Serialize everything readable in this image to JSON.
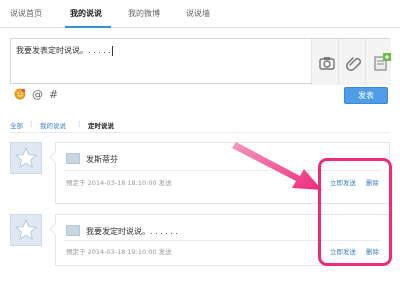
{
  "tabs": [
    {
      "label": "说说首页"
    },
    {
      "label": "我的说说"
    },
    {
      "label": "我的微博"
    },
    {
      "label": "说说墙"
    }
  ],
  "composer": {
    "text": "我要发表定时说说。. . . . ."
  },
  "tools": [
    "camera-icon",
    "link-icon",
    "schedule-icon"
  ],
  "toolbar_icons": [
    "emoji-icon",
    "mention-icon",
    "hashtag-icon"
  ],
  "send_label": "发表",
  "filter": [
    {
      "label": "全部"
    },
    {
      "label": "我的说说"
    },
    {
      "label": "定时说说"
    }
  ],
  "posts": [
    {
      "text": "发斯蒂芬",
      "meta": "预定于 2014-03-18 18:10:00 发送",
      "publish_now": "立即发送",
      "delete": "删除"
    },
    {
      "text": "我要发定时说说。. . . . . .",
      "meta": "预定于 2014-03-18 19:10:00 发送",
      "publish_now": "立即发送",
      "delete": "删除"
    }
  ],
  "annotation": {
    "color": "#ee2a7b"
  },
  "accent": "#4f9de6"
}
